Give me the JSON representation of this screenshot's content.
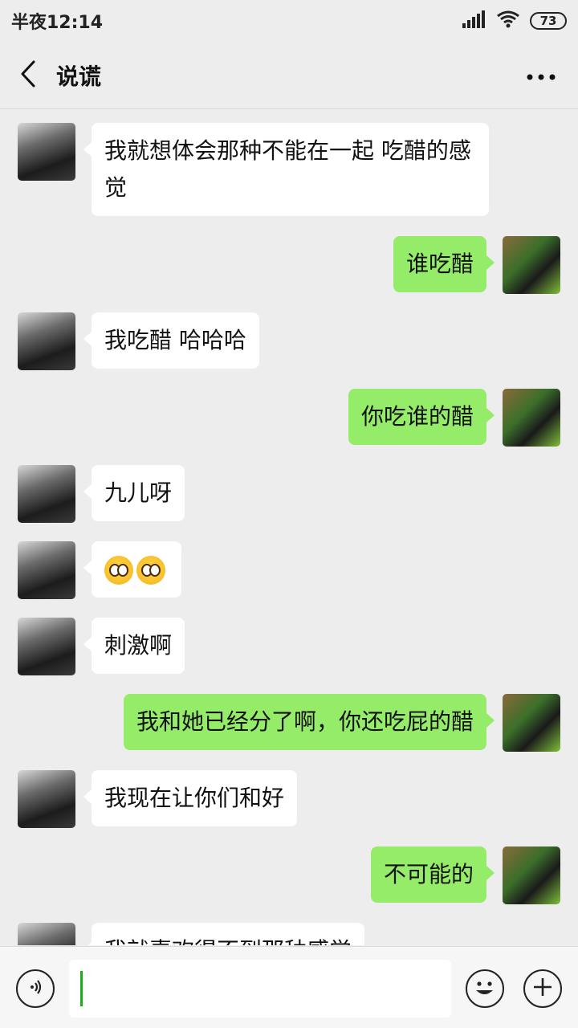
{
  "status_bar": {
    "time": "半夜12:14",
    "battery": "73",
    "signal_icon": "signal-icon",
    "wifi_icon": "wifi-icon"
  },
  "header": {
    "title": "说谎",
    "back_icon": "chevron-left-icon",
    "more_icon": "more-horizontal-icon"
  },
  "colors": {
    "background": "#ededed",
    "incoming_bubble": "#ffffff",
    "outgoing_bubble": "#95ec69",
    "cursor": "#1aad19"
  },
  "messages": [
    {
      "side": "left",
      "text": "我就想体会那种不能在一起 吃醋的感觉"
    },
    {
      "side": "right",
      "text": "谁吃醋"
    },
    {
      "side": "left",
      "text": "我吃醋 哈哈哈"
    },
    {
      "side": "right",
      "text": "你吃谁的醋"
    },
    {
      "side": "left",
      "text": "九儿呀"
    },
    {
      "side": "left",
      "type": "emoji",
      "emojis": [
        "flushed-face-emoji",
        "flushed-face-emoji"
      ]
    },
    {
      "side": "left",
      "text": "刺激啊"
    },
    {
      "side": "right",
      "text": "我和她已经分了啊，你还吃屁的醋"
    },
    {
      "side": "left",
      "text": "我现在让你们和好"
    },
    {
      "side": "right",
      "text": "不可能的"
    },
    {
      "side": "left",
      "text": "我就喜欢得不到那种感觉",
      "partially_hidden": true
    }
  ],
  "input_bar": {
    "value": "",
    "voice_icon": "voice-icon",
    "emoji_icon": "emoji-icon",
    "plus_icon": "plus-icon"
  }
}
